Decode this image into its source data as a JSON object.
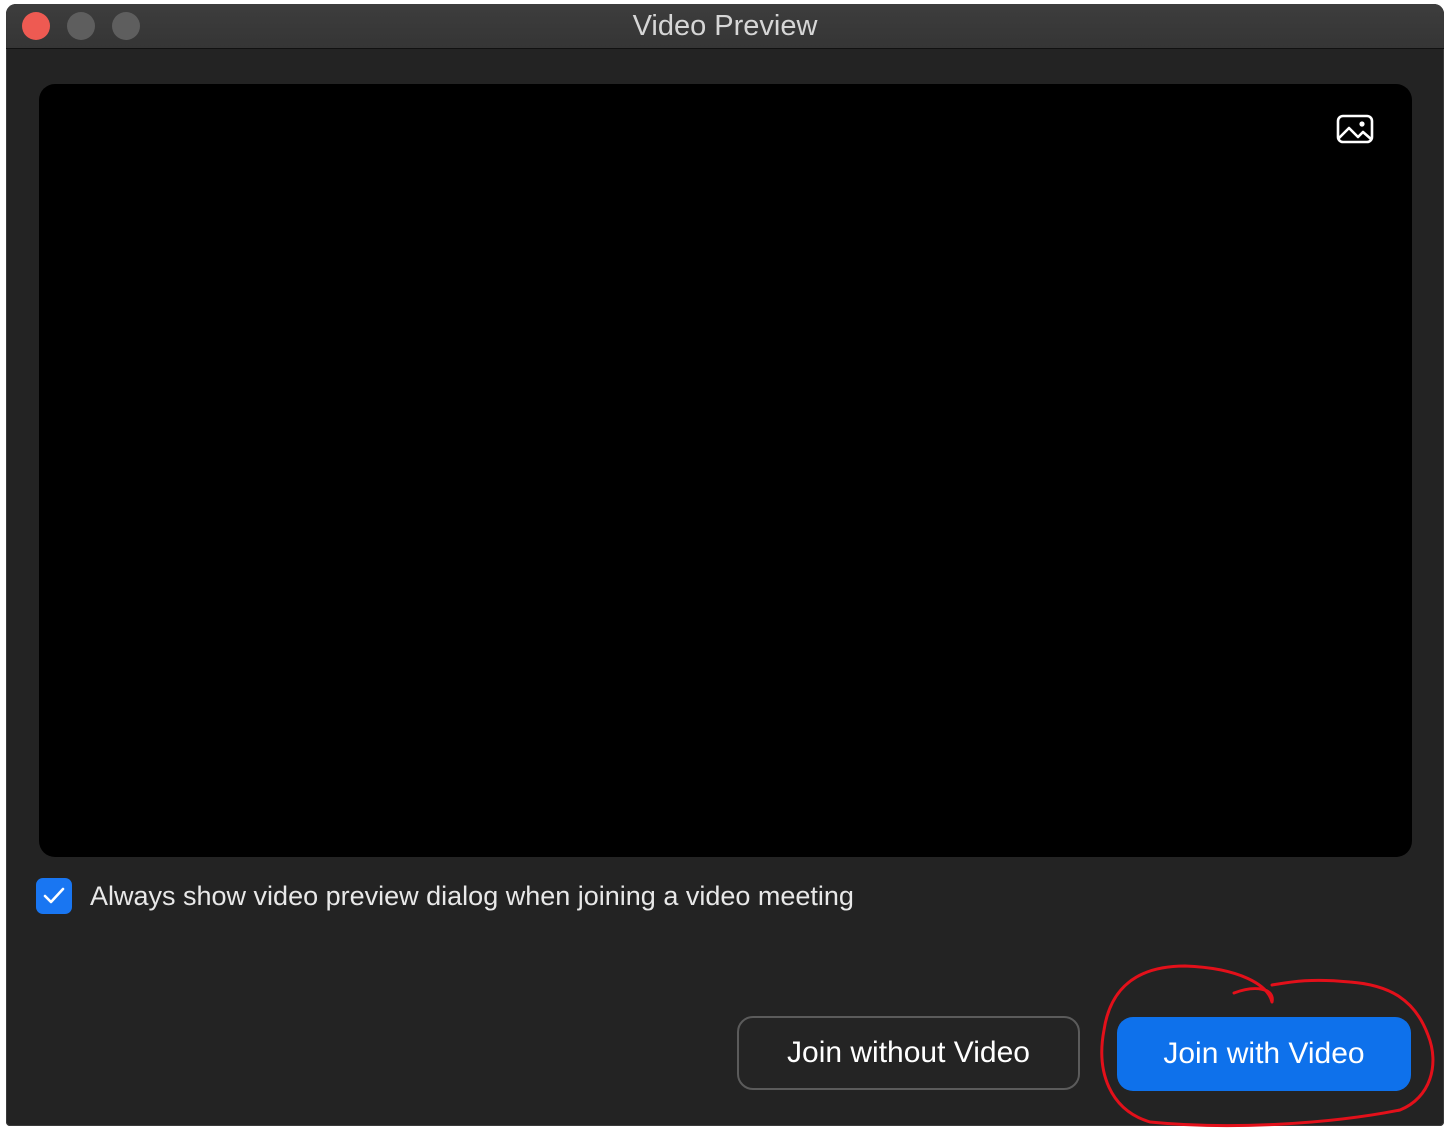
{
  "window": {
    "title": "Video Preview"
  },
  "preview": {
    "background_icon": "image-icon"
  },
  "options": {
    "always_show_preview_label": "Always show video preview dialog when joining a video meeting",
    "always_show_preview_checked": true
  },
  "buttons": {
    "join_without_video": "Join without Video",
    "join_with_video": "Join with Video"
  },
  "colors": {
    "primary": "#0E71EB",
    "checkbox": "#1976F2",
    "annotation": "#E3101A"
  }
}
